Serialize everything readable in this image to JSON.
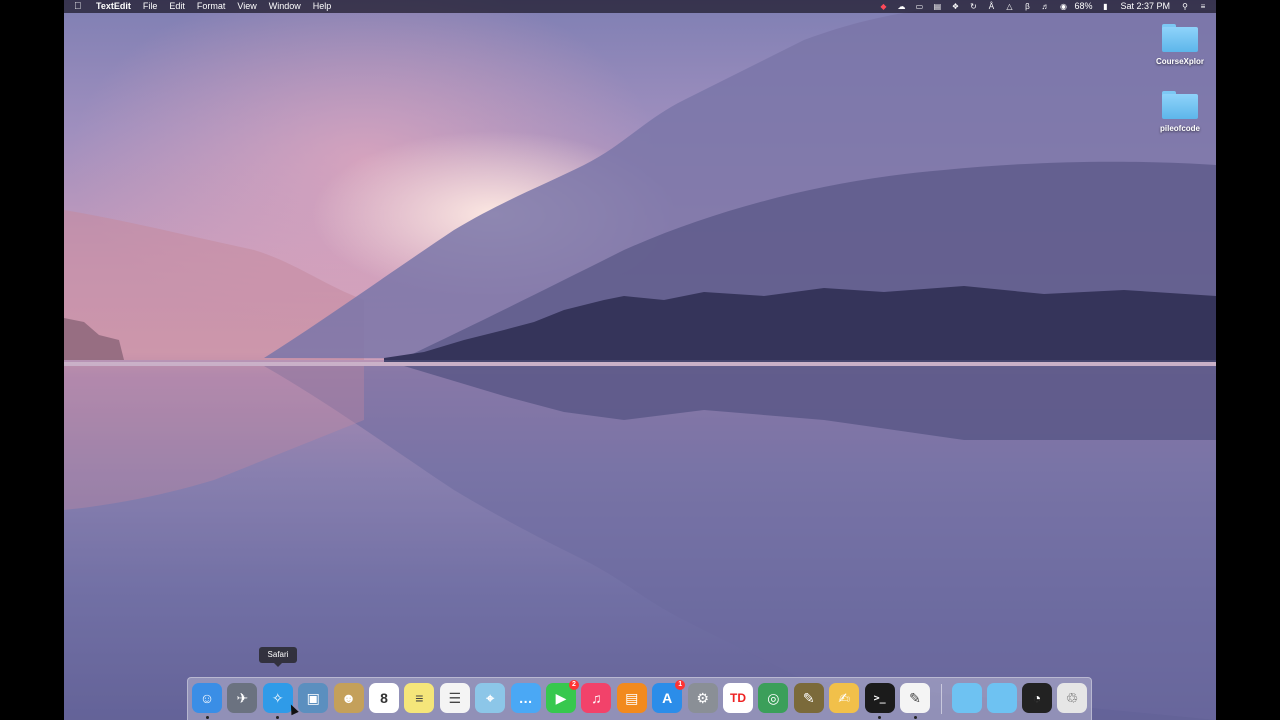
{
  "menubar": {
    "app_name": "TextEdit",
    "menus": [
      "File",
      "Edit",
      "Format",
      "View",
      "Window",
      "Help"
    ],
    "battery": "68%",
    "clock": "Sat 2:37 PM"
  },
  "desktop": {
    "folders": [
      {
        "label": "CourseXplor"
      },
      {
        "label": "pileofcode"
      }
    ]
  },
  "tooltip": "Safari",
  "dock": {
    "apps": [
      {
        "name": "Finder",
        "icon": "finder-icon",
        "color": "#3a8ee6",
        "running": true
      },
      {
        "name": "Launchpad",
        "icon": "rocket-icon",
        "color": "#6b7280",
        "running": false
      },
      {
        "name": "Safari",
        "icon": "compass-icon",
        "color": "#2f9be8",
        "running": true
      },
      {
        "name": "Preview",
        "icon": "photo-icon",
        "color": "#5b8fbf",
        "running": false
      },
      {
        "name": "Contacts",
        "icon": "contacts-icon",
        "color": "#c4a05a",
        "running": false
      },
      {
        "name": "Calendar",
        "icon": "calendar-icon",
        "color": "#ffffff",
        "running": false,
        "text": "8"
      },
      {
        "name": "Notes",
        "icon": "notes-icon",
        "color": "#f5e67a",
        "running": false
      },
      {
        "name": "Reminders",
        "icon": "reminders-icon",
        "color": "#f4f4f4",
        "running": false
      },
      {
        "name": "Maps",
        "icon": "maps-icon",
        "color": "#8cc6e8",
        "running": false
      },
      {
        "name": "Messages",
        "icon": "messages-icon",
        "color": "#4aa8f5",
        "running": false
      },
      {
        "name": "FaceTime",
        "icon": "facetime-icon",
        "color": "#37c84e",
        "running": false,
        "badge": "2"
      },
      {
        "name": "iTunes",
        "icon": "music-icon",
        "color": "#f2426a",
        "running": false
      },
      {
        "name": "iBooks",
        "icon": "book-icon",
        "color": "#f28a1e",
        "running": false
      },
      {
        "name": "App Store",
        "icon": "appstore-icon",
        "color": "#2b8de9",
        "running": false,
        "badge": "1"
      },
      {
        "name": "System Preferences",
        "icon": "gear-icon",
        "color": "#8a8f96",
        "running": false
      },
      {
        "name": "Tiny Dock",
        "icon": "td-icon",
        "color": "#ffffff",
        "running": false,
        "text": "TD"
      },
      {
        "name": "Globe",
        "icon": "globe-icon",
        "color": "#3b9f5a",
        "running": false
      },
      {
        "name": "Feather",
        "icon": "feather-icon",
        "color": "#7b6a3a",
        "running": false
      },
      {
        "name": "Pages",
        "icon": "pages-icon",
        "color": "#f1c04a",
        "running": false
      },
      {
        "name": "Terminal",
        "icon": "terminal-icon",
        "color": "#1b1b1b",
        "running": true
      },
      {
        "name": "TextEdit",
        "icon": "textedit-icon",
        "color": "#f4f4f4",
        "running": true
      }
    ],
    "stacks": [
      {
        "name": "Applications",
        "icon": "folder-icon",
        "color": "#6ec2f2"
      },
      {
        "name": "Documents",
        "icon": "folder-icon",
        "color": "#6ec2f2"
      },
      {
        "name": "AirDrop",
        "icon": "wifi-icon",
        "color": "#222222"
      },
      {
        "name": "Trash",
        "icon": "trash-icon",
        "color": "#e6e6e6"
      }
    ]
  }
}
